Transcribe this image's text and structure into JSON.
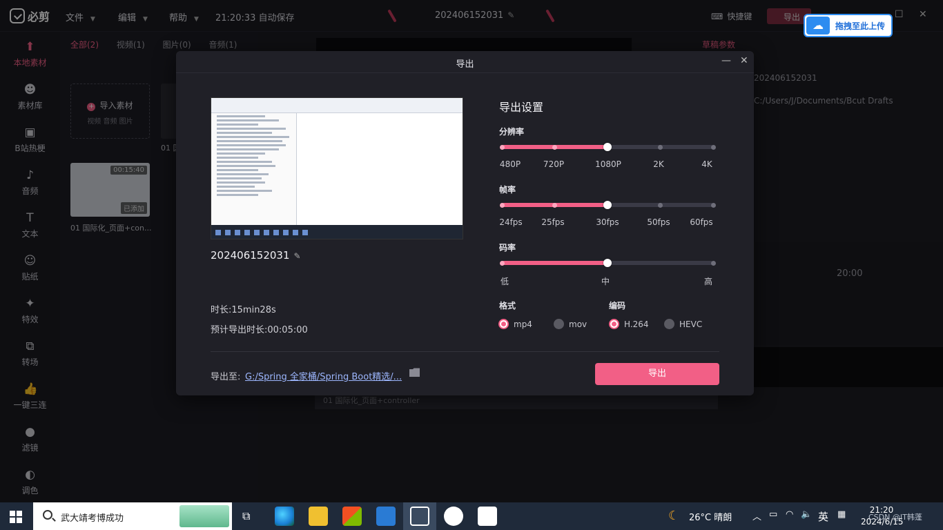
{
  "app": {
    "logo": "必剪",
    "menus": [
      "文件",
      "编辑",
      "帮助"
    ],
    "autosave": "21:20:33 自动保存",
    "project_title": "202406152031",
    "shortcut": "快捷键",
    "export_top": "导出",
    "upload_pill": "拖拽至此上传"
  },
  "sidebar": {
    "items": [
      {
        "label": "本地素材",
        "icon": "upload-icon",
        "glyph": "⬆"
      },
      {
        "label": "素材库",
        "icon": "library-icon",
        "glyph": "☻"
      },
      {
        "label": "B站热梗",
        "icon": "tv-icon",
        "glyph": "▣"
      },
      {
        "label": "音频",
        "icon": "music-icon",
        "glyph": "♪"
      },
      {
        "label": "文本",
        "icon": "text-icon",
        "glyph": "T"
      },
      {
        "label": "贴纸",
        "icon": "sticker-icon",
        "glyph": "☺"
      },
      {
        "label": "特效",
        "icon": "effects-icon",
        "glyph": "✦"
      },
      {
        "label": "转场",
        "icon": "transition-icon",
        "glyph": "⧉"
      },
      {
        "label": "一键三连",
        "icon": "thumbs-up-icon",
        "glyph": "👍"
      },
      {
        "label": "滤镜",
        "icon": "filter-icon",
        "glyph": "●"
      },
      {
        "label": "调色",
        "icon": "palette-icon",
        "glyph": "◐"
      }
    ]
  },
  "media": {
    "tabs": [
      "全部(2)",
      "视频(1)",
      "图片(0)",
      "音频(1)"
    ],
    "import_label": "导入素材",
    "import_sub": "视频  音频  图片",
    "item1_caption": "01 国",
    "item2_caption": "01 国际化_页面+con...",
    "item2_duration": "00:15:40",
    "item2_badge": "已添加"
  },
  "background": {
    "params_title": "草稿参数",
    "draft_name": "202406152031",
    "draft_path": "C:/Users/J/Documents/Bcut Drafts",
    "timecode": "20:00",
    "track_label": "01 国际化_页面+controller"
  },
  "dialog": {
    "title": "导出",
    "project_name": "202406152031",
    "duration": "时长:15min28s",
    "eta": "预计导出时长:00:05:00",
    "settings_title": "导出设置",
    "resolution": {
      "label": "分辨率",
      "stops": [
        "480P",
        "720P",
        "1080P",
        "2K",
        "4K"
      ],
      "selected": "1080P"
    },
    "framerate": {
      "label": "帧率",
      "stops": [
        "24fps",
        "25fps",
        "30fps",
        "50fps",
        "60fps"
      ],
      "selected": "30fps"
    },
    "bitrate": {
      "label": "码率",
      "stops": [
        "低",
        "中",
        "高"
      ],
      "selected": "中"
    },
    "format": {
      "label": "格式",
      "options": [
        "mp4",
        "mov"
      ],
      "selected": "mp4"
    },
    "codec": {
      "label": "编码",
      "options": [
        "H.264",
        "HEVC"
      ],
      "selected": "H.264"
    },
    "path_label": "导出至:",
    "path_value": "G:/Spring 全家桶/Spring Boot精选/...",
    "export_button": "导出"
  },
  "taskbar": {
    "search_text": "武大靖考博成功",
    "weather": "26°C  晴朗",
    "ime": "英",
    "time": "21:20",
    "date": "2024/6/15",
    "watermark": "CSDN @IT韩蓬"
  },
  "colors": {
    "accent": "#f25f86",
    "link": "#9db7ff"
  }
}
